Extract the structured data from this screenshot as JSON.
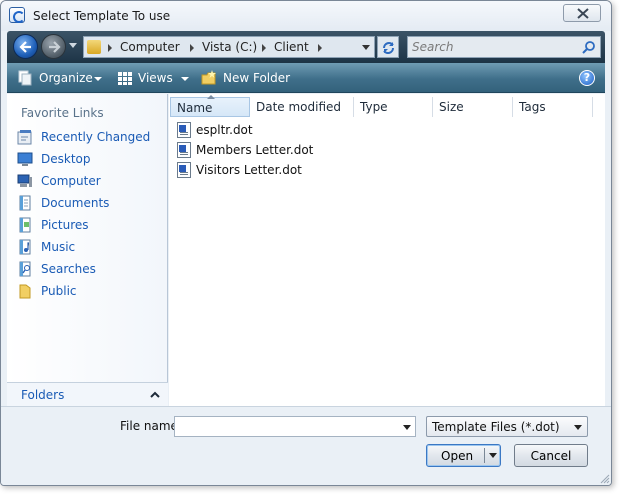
{
  "window": {
    "title": "Select Template To use"
  },
  "nav": {
    "breadcrumbs": [
      "Computer",
      "Vista (C:)",
      "Client"
    ],
    "search_placeholder": "Search"
  },
  "toolbar": {
    "organize_label": "Organize",
    "views_label": "Views",
    "new_folder_label": "New Folder",
    "help_glyph": "?"
  },
  "sidebar": {
    "title": "Favorite Links",
    "items": [
      {
        "label": "Recently Changed",
        "icon": "recently-changed-icon"
      },
      {
        "label": "Desktop",
        "icon": "desktop-icon"
      },
      {
        "label": "Computer",
        "icon": "computer-icon"
      },
      {
        "label": "Documents",
        "icon": "documents-icon"
      },
      {
        "label": "Pictures",
        "icon": "pictures-icon"
      },
      {
        "label": "Music",
        "icon": "music-icon"
      },
      {
        "label": "Searches",
        "icon": "searches-icon"
      },
      {
        "label": "Public",
        "icon": "public-folder-icon"
      }
    ],
    "folders_label": "Folders"
  },
  "filelist": {
    "columns": [
      "Name",
      "Date modified",
      "Type",
      "Size",
      "Tags"
    ],
    "sorted_column": "Name",
    "files": [
      {
        "name": "espltr.dot"
      },
      {
        "name": "Members Letter.dot"
      },
      {
        "name": "Visitors Letter.dot"
      }
    ]
  },
  "footer": {
    "file_name_label": "File name:",
    "file_name_value": "",
    "filter_value": "Template Files (*.dot)",
    "open_label": "Open",
    "cancel_label": "Cancel"
  },
  "colors": {
    "link_blue": "#1a5bb5",
    "toolbar_teal": "#3f6f8a",
    "navbar_dark": "#1d3446"
  }
}
